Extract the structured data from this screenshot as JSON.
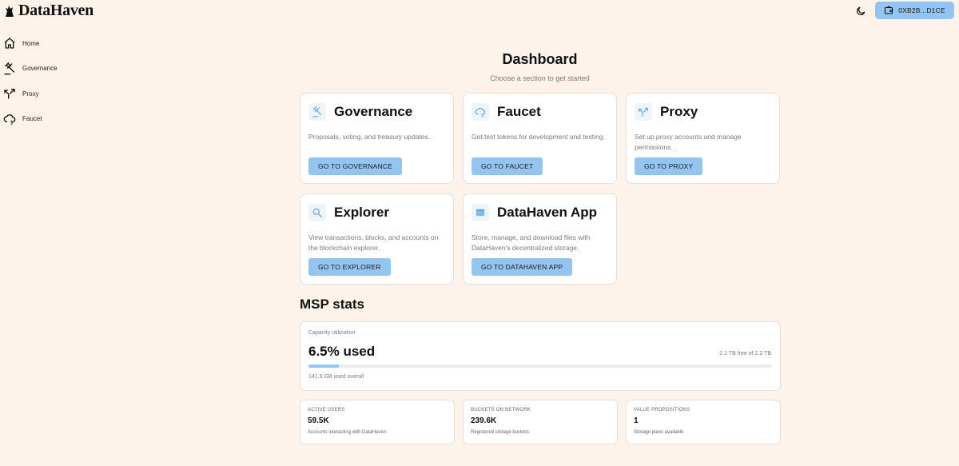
{
  "app": {
    "name": "DataHaven"
  },
  "sidebar": {
    "items": [
      {
        "label": "Home",
        "icon": "home-icon"
      },
      {
        "label": "Governance",
        "icon": "gavel-icon"
      },
      {
        "label": "Proxy",
        "icon": "split-arrows-icon"
      },
      {
        "label": "Faucet",
        "icon": "cloud-dollar-icon"
      }
    ]
  },
  "header": {
    "theme_icon": "moon-icon",
    "wallet_icon": "wallet-icon",
    "wallet_label": "0XB2B...D1CE"
  },
  "dashboard": {
    "title": "Dashboard",
    "subtitle": "Choose a section to get started",
    "cards": [
      {
        "title": "Governance",
        "icon": "gavel-icon",
        "description": "Proposals, voting, and treasury updates.",
        "button": "GO TO GOVERNANCE"
      },
      {
        "title": "Faucet",
        "icon": "cloud-dollar-icon",
        "description": "Get test tokens for development and testing.",
        "button": "GO TO FAUCET"
      },
      {
        "title": "Proxy",
        "icon": "split-arrows-icon",
        "description": "Set up proxy accounts and manage permissions.",
        "button": "GO TO PROXY"
      },
      {
        "title": "Explorer",
        "icon": "search-icon",
        "description": "View transactions, blocks, and accounts on the blockchain explorer.",
        "button": "GO TO EXPLORER"
      },
      {
        "title": "DataHaven App",
        "icon": "app-window-icon",
        "description": "Store, manage, and download files with DataHaven's decentralized storage.",
        "button": "GO TO DATAHAVEN APP"
      }
    ]
  },
  "msp": {
    "title": "MSP stats",
    "capacity": {
      "label": "Capacity utilization",
      "value": "6.5% used",
      "percent": 6.5,
      "free": "2.1 TB free of 2.2 TB",
      "used_overall": "141.9 GB used overall"
    },
    "stats": [
      {
        "label": "ACTIVE USERS",
        "value": "59.5K",
        "desc": "Accounts interacting with DataHaven"
      },
      {
        "label": "BUCKETS ON NETWORK",
        "value": "239.6K",
        "desc": "Registered storage buckets"
      },
      {
        "label": "VALUE PROPOSITIONS",
        "value": "1",
        "desc": "Storage plans available"
      }
    ]
  },
  "colors": {
    "background": "#fdf3ea",
    "accent": "#93c5f0",
    "icon_accent": "#5aa7e6"
  }
}
